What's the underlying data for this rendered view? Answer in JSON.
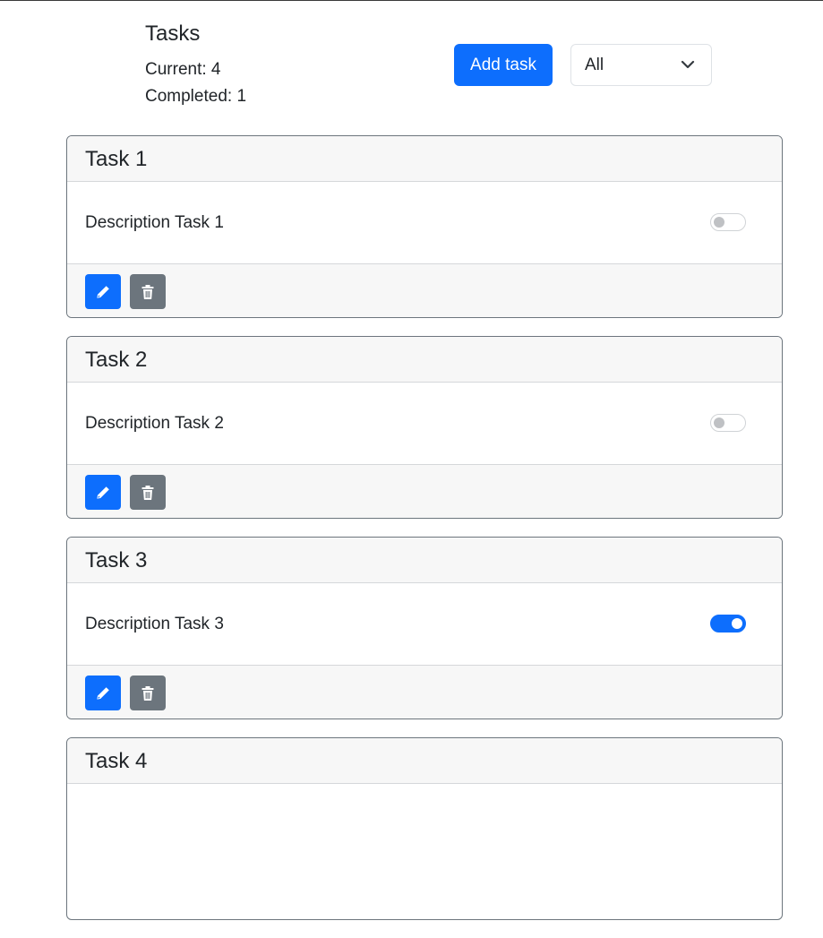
{
  "header": {
    "title": "Tasks",
    "current_label": "Current: 4",
    "completed_label": "Completed: 1",
    "add_button_label": "Add task",
    "filter_selected": "All"
  },
  "tasks": [
    {
      "title": "Task 1",
      "description": "Description Task 1",
      "completed": false
    },
    {
      "title": "Task 2",
      "description": "Description Task 2",
      "completed": false
    },
    {
      "title": "Task 3",
      "description": "Description Task 3",
      "completed": true
    },
    {
      "title": "Task 4",
      "description": "",
      "completed": false
    }
  ],
  "icons": {
    "edit": "pencil-icon",
    "delete": "trash-icon",
    "filter": "chevron-down-icon"
  },
  "colors": {
    "primary": "#0d6efd",
    "secondary": "#6c757d"
  }
}
